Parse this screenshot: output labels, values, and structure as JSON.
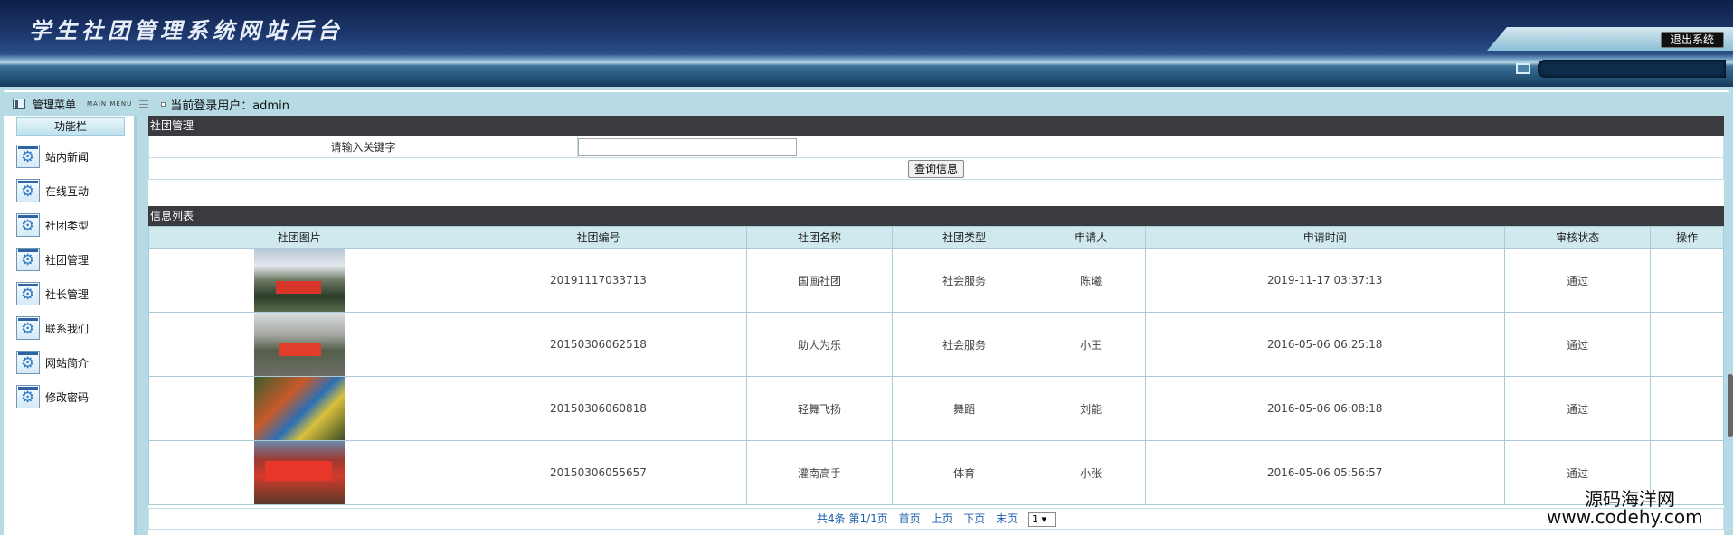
{
  "header": {
    "title": "学生社团管理系统网站后台",
    "logout_label": "退出系统"
  },
  "topbar": {
    "menu_title": "管理菜单",
    "menu_subtitle": "MAIN MENU",
    "user_label": "当前登录用户：admin"
  },
  "sidebar": {
    "title": "功能栏",
    "items": [
      {
        "label": "站内新闻",
        "icon": "gear-icon"
      },
      {
        "label": "在线互动",
        "icon": "gear-icon"
      },
      {
        "label": "社团类型",
        "icon": "gear-icon"
      },
      {
        "label": "社团管理",
        "icon": "gear-icon"
      },
      {
        "label": "社长管理",
        "icon": "gear-icon"
      },
      {
        "label": "联系我们",
        "icon": "gear-icon"
      },
      {
        "label": "网站简介",
        "icon": "gear-icon"
      },
      {
        "label": "修改密码",
        "icon": "gear-icon"
      }
    ]
  },
  "search": {
    "section_title": "社团管理",
    "keyword_label": "请输入关键字",
    "keyword_value": "",
    "query_button": "查询信息"
  },
  "list": {
    "section_title": "信息列表",
    "columns": [
      "社团图片",
      "社团编号",
      "社团名称",
      "社团类型",
      "申请人",
      "申请时间",
      "审核状态",
      "操作"
    ],
    "rows": [
      {
        "id": "20191117033713",
        "name": "国画社团",
        "type": "社会服务",
        "applicant": "陈曦",
        "time": "2019-11-17 03:37:13",
        "status": "通过",
        "action": ""
      },
      {
        "id": "20150306062518",
        "name": "助人为乐",
        "type": "社会服务",
        "applicant": "小王",
        "time": "2016-05-06 06:25:18",
        "status": "通过",
        "action": ""
      },
      {
        "id": "20150306060818",
        "name": "轻舞飞扬",
        "type": "舞蹈",
        "applicant": "刘能",
        "time": "2016-05-06 06:08:18",
        "status": "通过",
        "action": ""
      },
      {
        "id": "20150306055657",
        "name": "灌南高手",
        "type": "体育",
        "applicant": "小张",
        "time": "2016-05-06 05:56:57",
        "status": "通过",
        "action": ""
      }
    ]
  },
  "pager": {
    "summary": "共4条 第1/1页",
    "first": "首页",
    "prev": "上页",
    "next": "下页",
    "last": "末页",
    "page_value": "1 ▾"
  },
  "watermark": {
    "cn": "源码海洋网",
    "url": "www.codehy.com"
  },
  "colors": {
    "header_dark": "#1d386e",
    "frame": "#b6dbe5",
    "section_bar": "#3a3b3f",
    "table_header": "#cfe9ee",
    "link": "#1f5fae"
  }
}
